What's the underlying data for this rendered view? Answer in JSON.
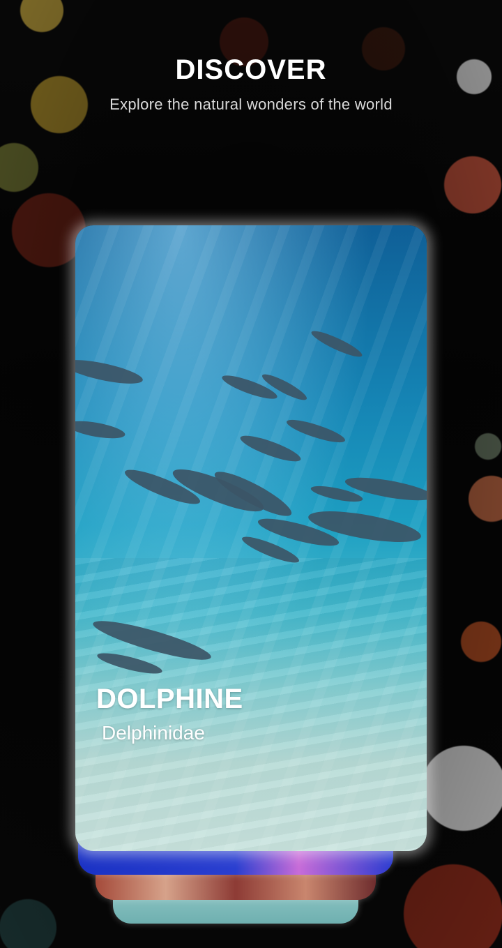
{
  "header": {
    "title": "DISCOVER",
    "subtitle": "Explore the natural wonders of the world"
  },
  "active_card": {
    "title": "DOLPHINE",
    "subtitle": "Delphinidae"
  },
  "colors": {
    "background": "#070707",
    "text": "#ffffff",
    "card_glow": "#ffffff"
  }
}
